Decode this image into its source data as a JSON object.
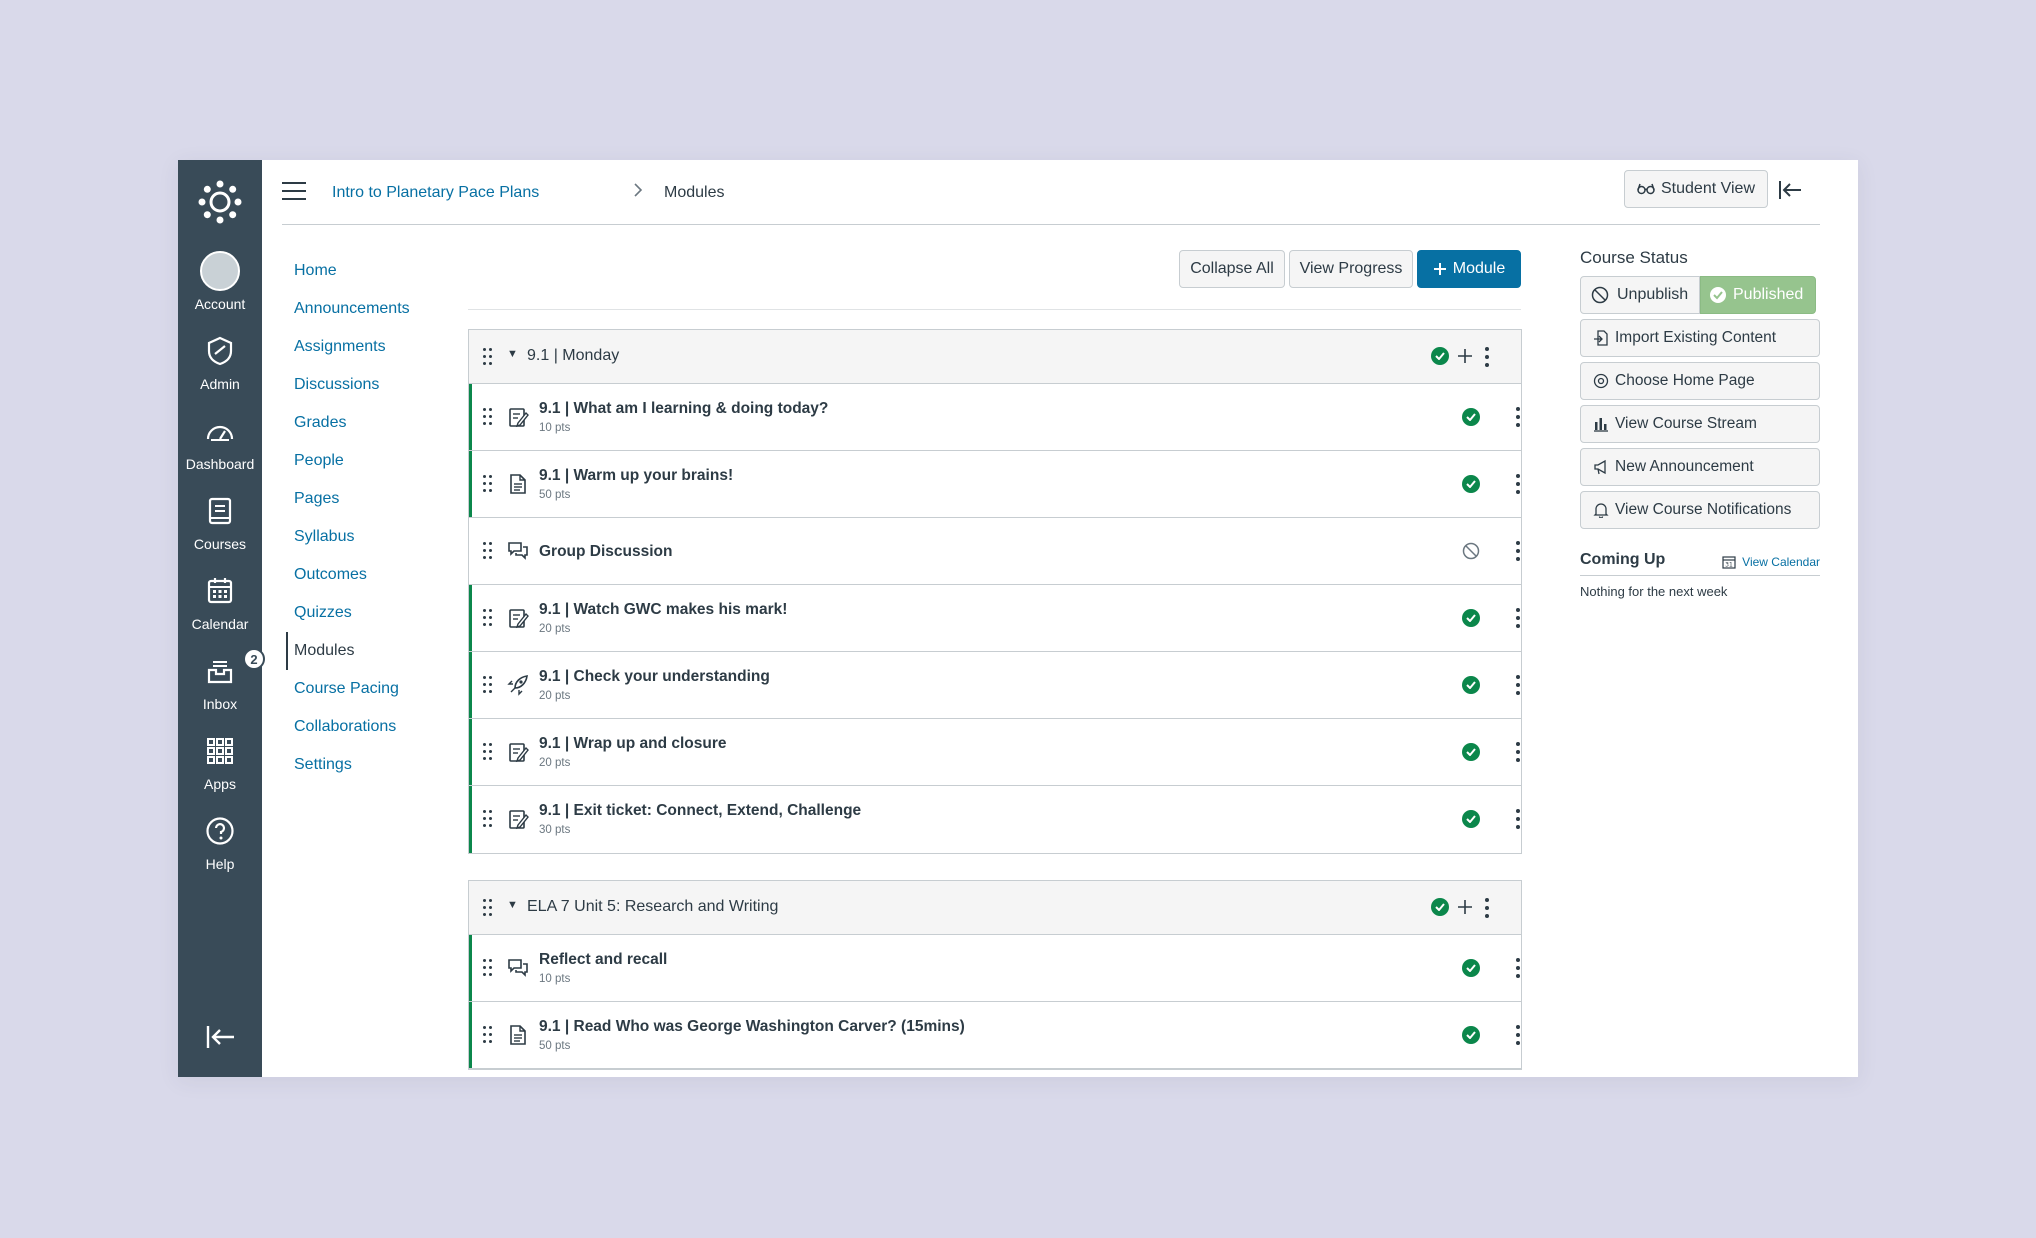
{
  "global_nav": {
    "items": [
      {
        "label": "Account",
        "icon": "avatar-icon"
      },
      {
        "label": "Admin",
        "icon": "shield-icon"
      },
      {
        "label": "Dashboard",
        "icon": "speedometer-icon"
      },
      {
        "label": "Courses",
        "icon": "book-icon"
      },
      {
        "label": "Calendar",
        "icon": "calendar-icon"
      },
      {
        "label": "Inbox",
        "icon": "inbox-icon",
        "badge": "2"
      },
      {
        "label": "Apps",
        "icon": "grid-icon"
      },
      {
        "label": "Help",
        "icon": "help-icon"
      }
    ]
  },
  "header": {
    "course_link": "Intro to Planetary Pace Plans",
    "current_page": "Modules",
    "student_view_label": "Student View"
  },
  "course_nav": {
    "items": [
      "Home",
      "Announcements",
      "Assignments",
      "Discussions",
      "Grades",
      "People",
      "Pages",
      "Syllabus",
      "Outcomes",
      "Quizzes",
      "Modules",
      "Course Pacing",
      "Collaborations",
      "Settings"
    ],
    "active": "Modules"
  },
  "toolbar": {
    "collapse_all": "Collapse All",
    "view_progress": "View Progress",
    "add_module": "Module"
  },
  "modules": [
    {
      "title": "9.1 | Monday",
      "items": [
        {
          "title": "9.1 | What am I learning & doing today?",
          "pts": "10 pts",
          "type": "assignment",
          "published": true
        },
        {
          "title": "9.1 | Warm up your brains!",
          "pts": "50 pts",
          "type": "page",
          "published": true
        },
        {
          "title": "Group Discussion",
          "pts": "",
          "type": "discussion",
          "published": false
        },
        {
          "title": "9.1 | Watch GWC makes his mark!",
          "pts": "20 pts",
          "type": "assignment",
          "published": true
        },
        {
          "title": "9.1 | Check your understanding",
          "pts": "20 pts",
          "type": "quiz",
          "published": true
        },
        {
          "title": "9.1 | Wrap up and closure",
          "pts": "20 pts",
          "type": "assignment",
          "published": true
        },
        {
          "title": "9.1 | Exit ticket: Connect, Extend, Challenge",
          "pts": "30 pts",
          "type": "assignment",
          "published": true
        }
      ]
    },
    {
      "title": "ELA 7 Unit 5: Research and Writing",
      "items": [
        {
          "title": "Reflect and recall",
          "pts": "10 pts",
          "type": "discussion",
          "published": true
        },
        {
          "title": "9.1 | Read Who was George Washington Carver? (15mins)",
          "pts": "50 pts",
          "type": "page",
          "published": true
        }
      ]
    }
  ],
  "sidebar": {
    "course_status_title": "Course Status",
    "unpublish_label": "Unpublish",
    "published_label": "Published",
    "buttons": [
      "Import Existing Content",
      "Choose Home Page",
      "View Course Stream",
      "New Announcement",
      "View Course Notifications"
    ],
    "coming_up_title": "Coming Up",
    "view_calendar_label": "View Calendar",
    "coming_up_empty": "Nothing for the next week"
  },
  "colors": {
    "nav_bg": "#394b58",
    "link": "#0770a3",
    "published_green": "#0b874b",
    "published_button": "#96c48e",
    "page_bg": "#d9d9ea"
  }
}
